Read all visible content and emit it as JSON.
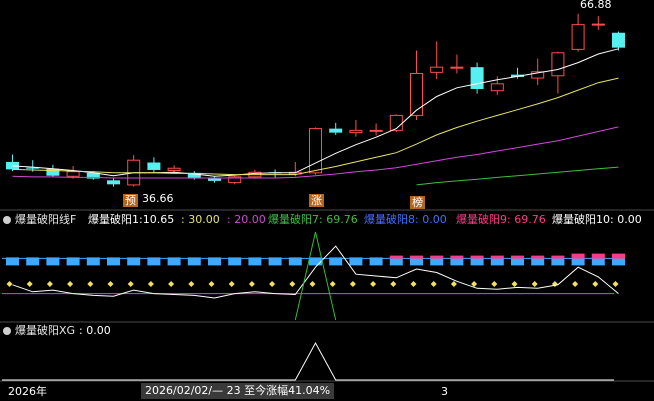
{
  "colors": {
    "up": "#ff4d4d",
    "down": "#56f0f0",
    "ma_short": "#ffffff",
    "ma_mid": "#e8e36a",
    "ma_long": "#d04ad6",
    "ma_xlong": "#3fbf3f",
    "line_cyan": "#3fa9ff",
    "line_pink": "#ff3a8a",
    "diamond": "#f2e15a",
    "spike": "#2fbf2f"
  },
  "main": {
    "high_label": "66.88",
    "low_label": "36.66",
    "tag_yu": "预",
    "tag_zhang": "涨",
    "tag_bang": "榜"
  },
  "panel1": {
    "title": "爆量破阳线F",
    "items": [
      {
        "label": "爆量破阳1:",
        "value": "10.65",
        "color": "#ffffff"
      },
      {
        "label": ":",
        "value": "30.00",
        "color": "#e8e36a"
      },
      {
        "label": ":",
        "value": "20.00",
        "color": "#d04ad6"
      },
      {
        "label": "爆量破阳7:",
        "value": "69.76",
        "color": "#3fbf3f"
      },
      {
        "label": "爆量破阳8:",
        "value": "0.00",
        "color": "#3f6fff"
      },
      {
        "label": "爆量破阳9:",
        "value": "69.76",
        "color": "#ff3a8a"
      },
      {
        "label": "爆量破阳10:",
        "value": "0.00",
        "color": "#ffffff"
      }
    ]
  },
  "panel2": {
    "title": "爆量破阳XG",
    "value_text": ": 0.00"
  },
  "footer": {
    "year": "2026年",
    "cursor_text": "2026/02/02/— 23 至今涨幅41.04%",
    "mark": "3"
  },
  "chart_data": {
    "type": "candlestick",
    "candles": [
      {
        "o": 41.5,
        "h": 42.8,
        "l": 39.9,
        "c": 40.2
      },
      {
        "o": 40.5,
        "h": 41.8,
        "l": 39.8,
        "c": 40.4
      },
      {
        "o": 40.3,
        "h": 41.0,
        "l": 38.9,
        "c": 39.1
      },
      {
        "o": 39.0,
        "h": 40.8,
        "l": 38.6,
        "c": 39.8
      },
      {
        "o": 39.6,
        "h": 39.9,
        "l": 38.4,
        "c": 38.6
      },
      {
        "o": 38.3,
        "h": 38.7,
        "l": 37.2,
        "c": 37.6
      },
      {
        "o": 37.5,
        "h": 42.7,
        "l": 37.2,
        "c": 41.8
      },
      {
        "o": 41.4,
        "h": 42.3,
        "l": 39.7,
        "c": 40.1
      },
      {
        "o": 40.0,
        "h": 40.9,
        "l": 39.6,
        "c": 40.4
      },
      {
        "o": 39.6,
        "h": 39.9,
        "l": 38.4,
        "c": 38.6
      },
      {
        "o": 38.6,
        "h": 39.0,
        "l": 37.9,
        "c": 38.2
      },
      {
        "o": 37.9,
        "h": 39.1,
        "l": 37.6,
        "c": 38.9
      },
      {
        "o": 38.9,
        "h": 40.1,
        "l": 38.6,
        "c": 39.7
      },
      {
        "o": 39.7,
        "h": 40.2,
        "l": 38.8,
        "c": 39.5
      },
      {
        "o": 39.4,
        "h": 41.5,
        "l": 39.0,
        "c": 39.7
      },
      {
        "o": 39.6,
        "h": 47.5,
        "l": 39.3,
        "c": 47.3
      },
      {
        "o": 47.3,
        "h": 48.3,
        "l": 46.2,
        "c": 46.6
      },
      {
        "o": 46.6,
        "h": 48.8,
        "l": 45.9,
        "c": 47.0
      },
      {
        "o": 46.9,
        "h": 48.2,
        "l": 46.1,
        "c": 47.0
      },
      {
        "o": 47.0,
        "h": 49.8,
        "l": 46.7,
        "c": 49.6
      },
      {
        "o": 49.6,
        "h": 60.9,
        "l": 48.8,
        "c": 56.9
      },
      {
        "o": 57.1,
        "h": 62.5,
        "l": 55.9,
        "c": 58.0
      },
      {
        "o": 58.0,
        "h": 60.2,
        "l": 56.9,
        "c": 58.0
      },
      {
        "o": 58.0,
        "h": 58.8,
        "l": 53.4,
        "c": 54.2
      },
      {
        "o": 53.9,
        "h": 56.4,
        "l": 53.2,
        "c": 55.1
      },
      {
        "o": 56.7,
        "h": 57.9,
        "l": 56.0,
        "c": 56.3
      },
      {
        "o": 56.1,
        "h": 59.5,
        "l": 54.9,
        "c": 57.2
      },
      {
        "o": 56.5,
        "h": 60.7,
        "l": 53.4,
        "c": 60.5
      },
      {
        "o": 61.1,
        "h": 67.3,
        "l": 60.7,
        "c": 65.4
      },
      {
        "o": 65.4,
        "h": 66.9,
        "l": 64.5,
        "c": 65.5
      },
      {
        "o": 64.0,
        "h": 64.2,
        "l": 60.9,
        "c": 61.4
      }
    ],
    "ma_short": [
      40.8,
      40.6,
      40.3,
      40.0,
      39.6,
      39.1,
      39.6,
      39.6,
      39.7,
      39.4,
      39.0,
      39.2,
      39.5,
      39.6,
      39.6,
      41.3,
      43.0,
      44.5,
      45.8,
      47.3,
      50.5,
      52.9,
      54.4,
      55.1,
      55.8,
      56.4,
      57.0,
      57.6,
      58.8,
      60.3,
      61.2
    ],
    "ma_mid": [
      40.2,
      40.1,
      40.0,
      39.9,
      39.8,
      39.6,
      39.6,
      39.6,
      39.5,
      39.5,
      39.4,
      39.3,
      39.3,
      39.3,
      39.3,
      40.0,
      40.7,
      41.5,
      42.3,
      43.1,
      44.6,
      46.2,
      47.5,
      48.6,
      49.6,
      50.6,
      51.6,
      52.7,
      54.0,
      55.3,
      56.1
    ],
    "ma_long": [
      39.0,
      38.9,
      38.9,
      38.8,
      38.8,
      38.7,
      38.7,
      38.7,
      38.7,
      38.7,
      38.7,
      38.7,
      38.7,
      38.7,
      38.8,
      39.1,
      39.4,
      39.8,
      40.1,
      40.5,
      41.1,
      41.7,
      42.3,
      42.8,
      43.4,
      44.0,
      44.6,
      45.2,
      46.0,
      46.8,
      47.6
    ],
    "ma_xlong_from": 20,
    "ma_xlong": [
      37.5,
      37.9,
      38.2,
      38.5,
      38.8,
      39.1,
      39.4,
      39.7,
      40.0,
      40.3,
      40.6
    ],
    "ind_white": [
      40,
      32,
      34,
      30,
      28,
      27,
      34,
      30,
      29,
      28,
      25,
      30,
      32,
      30,
      29,
      60,
      84,
      52,
      50,
      48,
      58,
      54,
      44,
      36,
      35,
      37,
      36,
      40,
      60,
      49,
      30
    ],
    "ind_green_spike_at": 15,
    "ind_levels": {
      "pink": 69.76,
      "cyan_ref": 70.0,
      "purple_ref": 30.0
    },
    "ind_pink_start": 19,
    "ind_diamond_level": 50,
    "xg_spike_at": 15,
    "ylim_main": [
      34.0,
      69.0
    ],
    "ylim_ind": [
      0,
      100
    ]
  }
}
